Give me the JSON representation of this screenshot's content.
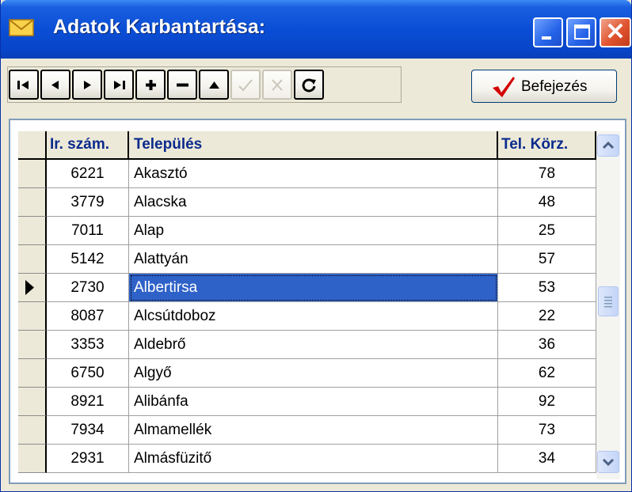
{
  "window": {
    "title": "Adatok Karbantartása:"
  },
  "toolbar": {
    "nav_buttons": [
      {
        "icon": "first-record-icon",
        "enabled": true
      },
      {
        "icon": "prior-record-icon",
        "enabled": true
      },
      {
        "icon": "next-record-icon",
        "enabled": true
      },
      {
        "icon": "last-record-icon",
        "enabled": true
      },
      {
        "icon": "insert-record-icon",
        "enabled": true
      },
      {
        "icon": "delete-record-icon",
        "enabled": true
      },
      {
        "icon": "edit-record-icon",
        "enabled": true
      },
      {
        "icon": "post-edit-icon",
        "enabled": false
      },
      {
        "icon": "cancel-edit-icon",
        "enabled": false
      },
      {
        "icon": "refresh-icon",
        "enabled": true
      }
    ],
    "done_label": "Befejezés"
  },
  "grid": {
    "columns": [
      "Ir. szám.",
      "Település",
      "Tel. Körz."
    ],
    "rows": [
      {
        "zip": "6221",
        "town": "Akasztó",
        "area": "78"
      },
      {
        "zip": "3779",
        "town": "Alacska",
        "area": "48"
      },
      {
        "zip": "7011",
        "town": "Alap",
        "area": "25"
      },
      {
        "zip": "5142",
        "town": "Alattyán",
        "area": "57"
      },
      {
        "zip": "2730",
        "town": "Albertirsa",
        "area": "53"
      },
      {
        "zip": "8087",
        "town": "Alcsútdoboz",
        "area": "22"
      },
      {
        "zip": "3353",
        "town": "Aldebrő",
        "area": "36"
      },
      {
        "zip": "6750",
        "town": "Algyő",
        "area": "62"
      },
      {
        "zip": "8921",
        "town": "Alibánfa",
        "area": "92"
      },
      {
        "zip": "7934",
        "town": "Almamellék",
        "area": "73"
      },
      {
        "zip": "2931",
        "town": "Almásfüzitő",
        "area": "34"
      }
    ],
    "selected_row": 4
  },
  "colors": {
    "accent": "#2f62c8",
    "header_text": "#0b2a8c",
    "title_bar": "#0a4ed6",
    "done_check": "#d40000"
  }
}
